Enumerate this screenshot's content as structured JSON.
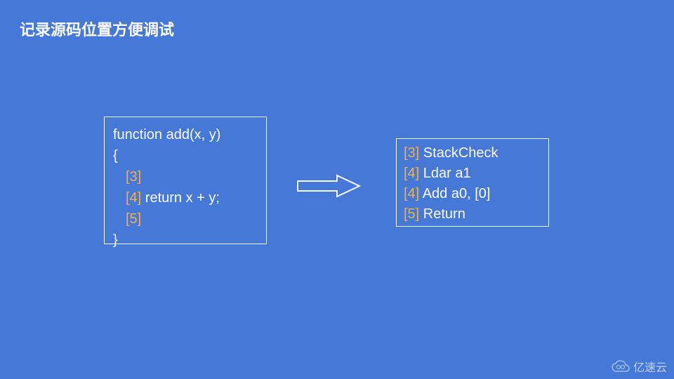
{
  "title": "记录源码位置方便调试",
  "source": {
    "line1": "function add(x, y)",
    "line2": "{",
    "line3": "[3]",
    "line4_label": "[4]",
    "line4_code": " return x + y;",
    "line5": "[5]",
    "line6": "}"
  },
  "bytecode": {
    "row1_label": "[3]",
    "row1_op": " StackCheck",
    "row2_label": "[4]",
    "row2_op": " Ldar a1",
    "row3_label": "[4]",
    "row3_op": " Add a0, [0]",
    "row4_label": "[5]",
    "row4_op": " Return"
  },
  "watermark": "亿速云"
}
